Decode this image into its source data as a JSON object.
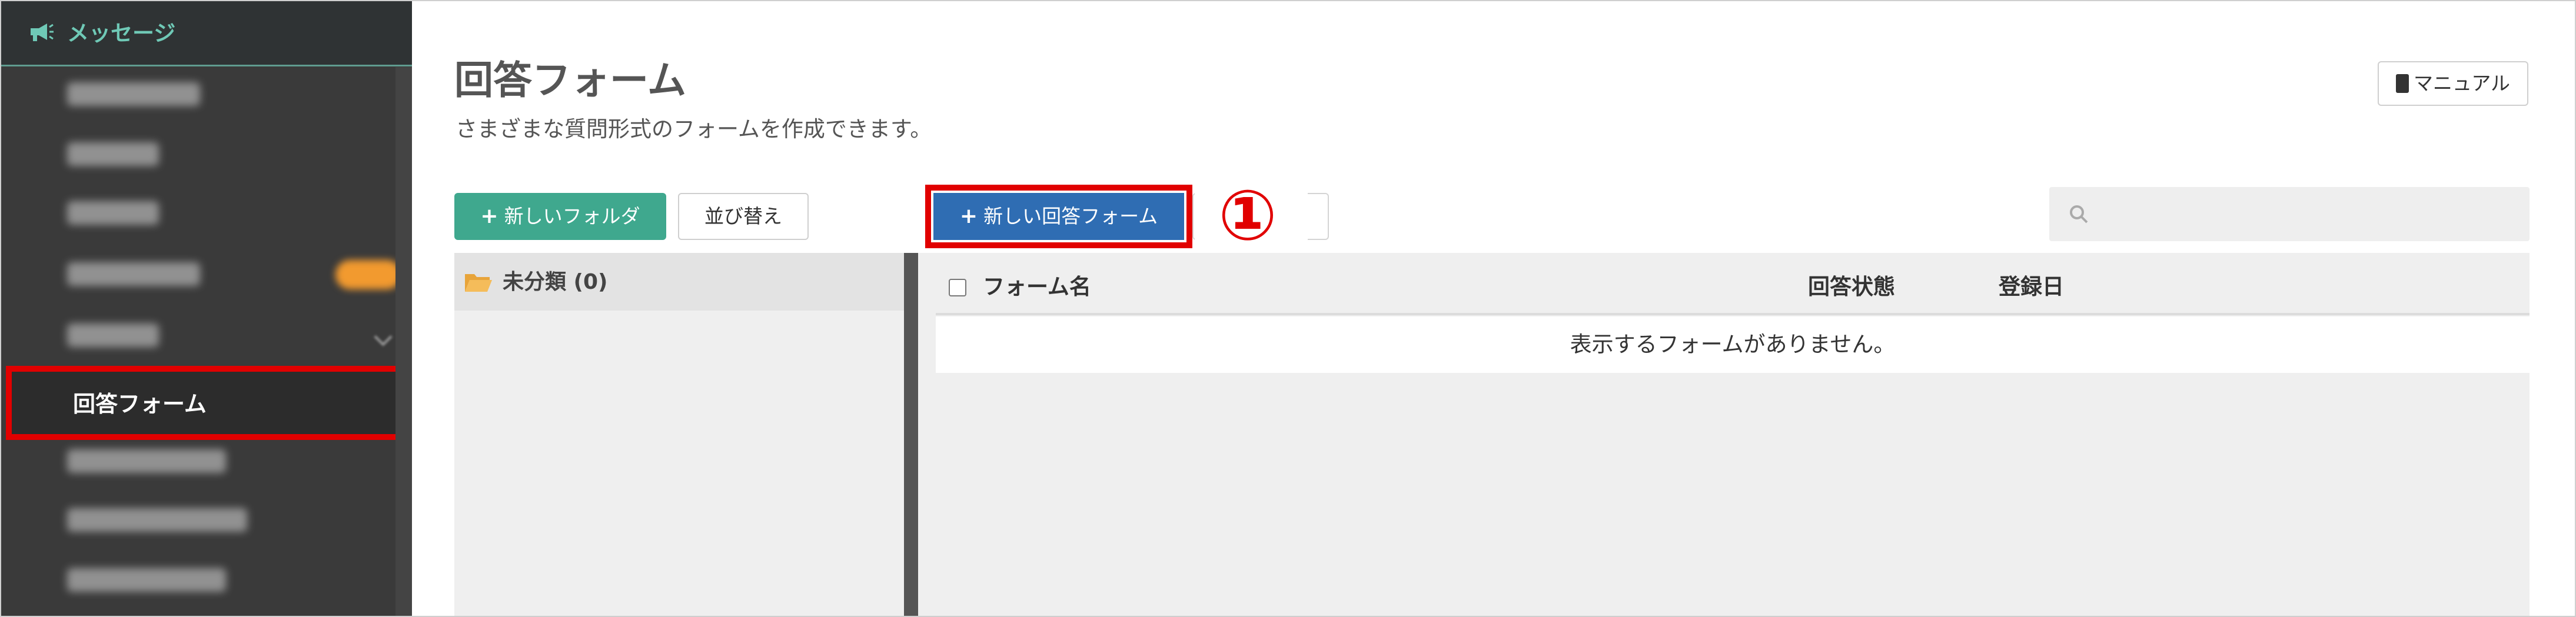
{
  "sidebar": {
    "header_label": "メッセージ",
    "active_item_label": "回答フォーム",
    "blurred_items": [
      {
        "name": "blurred-item-1"
      },
      {
        "name": "blurred-item-2"
      },
      {
        "name": "blurred-item-3"
      },
      {
        "name": "blurred-item-4",
        "badge": true
      },
      {
        "name": "blurred-item-5",
        "chevron": true
      },
      {
        "name": "blurred-item-7"
      },
      {
        "name": "blurred-item-8"
      },
      {
        "name": "blurred-item-9"
      }
    ]
  },
  "header": {
    "title": "回答フォーム",
    "subtitle": "さまざまな質問形式のフォームを作成できます。",
    "manual_label": "マニュアル"
  },
  "toolbar": {
    "new_folder_label": "新しいフォルダ",
    "sort_label": "並び替え",
    "new_form_label": "新しい回答フォーム",
    "callout_marker": "①",
    "search_placeholder": ""
  },
  "folders": [
    {
      "label": "未分類 (0)"
    }
  ],
  "table": {
    "columns": {
      "name": "フォーム名",
      "status": "回答状態",
      "date": "登録日"
    },
    "empty_message": "表示するフォームがありません。"
  },
  "colors": {
    "highlight": "#e10000",
    "primary": "#2f6db3",
    "success": "#3fa88e",
    "sidebar_bg": "#3a3a3a",
    "sidebar_accent": "#6fc9b6"
  }
}
